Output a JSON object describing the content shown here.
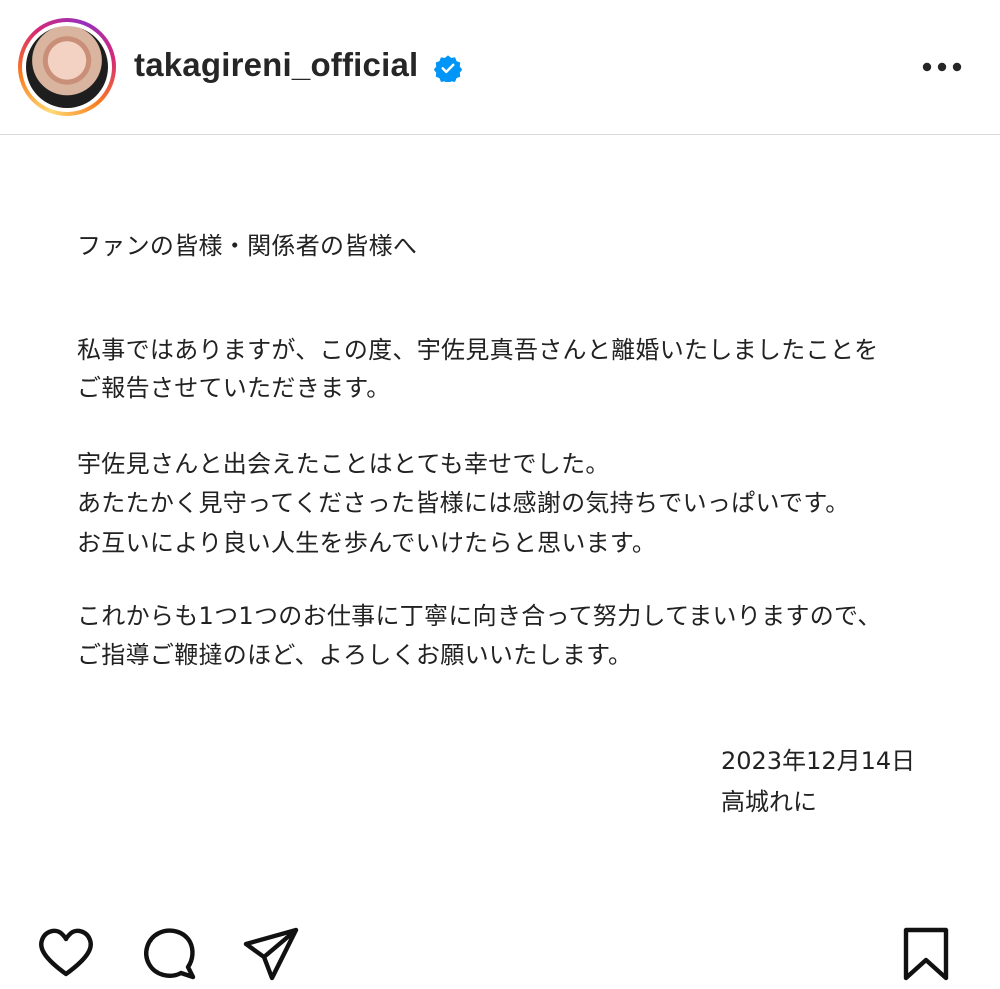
{
  "header": {
    "username": "takagireni_official",
    "verified_icon": "verified-badge-icon",
    "more_icon": "more-options-icon"
  },
  "post": {
    "greeting": "ファンの皆様・関係者の皆様へ",
    "paragraph1": [
      "私事ではありますが、この度、宇佐見真吾さんと離婚いたしましたことを",
      "ご報告させていただきます。"
    ],
    "paragraph2": [
      "宇佐見さんと出会えたことはとても幸せでした。",
      "あたたかく見守ってくださった皆様には感謝の気持ちでいっぱいです。",
      "お互いにより良い人生を歩んでいけたらと思います。"
    ],
    "paragraph3": [
      "これからも1つ1つのお仕事に丁寧に向き合って努力してまいりますので、",
      "ご指導ご鞭撻のほど、よろしくお願いいたします。"
    ],
    "date": "2023年12月14日",
    "signature": "高城れに"
  },
  "actions": {
    "like_icon": "heart-icon",
    "comment_icon": "comment-icon",
    "share_icon": "share-icon",
    "save_icon": "bookmark-icon"
  },
  "colors": {
    "text": "#262626",
    "verified": "#0095f6",
    "divider": "#dbdbdb"
  }
}
